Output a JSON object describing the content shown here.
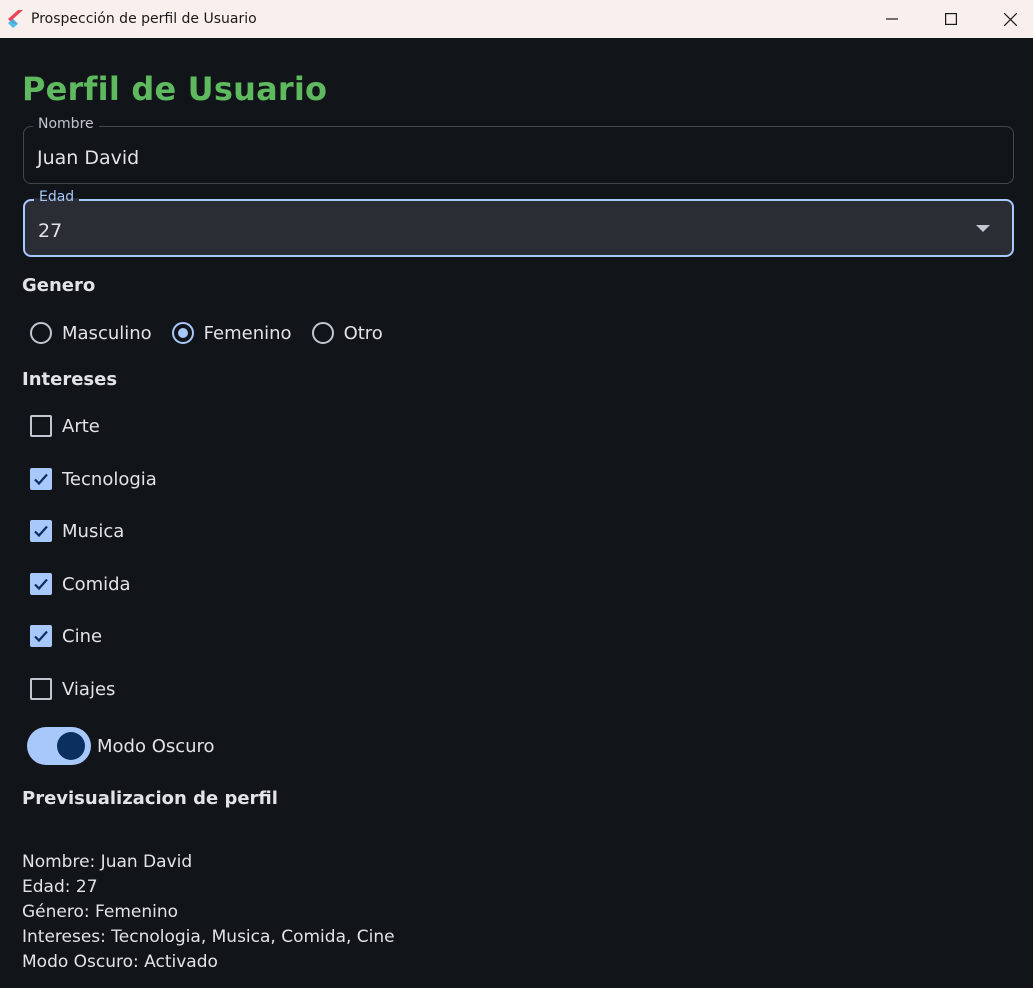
{
  "window": {
    "title": "Prospección de perfil de Usuario",
    "icon": "flutter-logo-icon"
  },
  "page": {
    "title": "Perfil de Usuario"
  },
  "form": {
    "nombre": {
      "label": "Nombre",
      "value": "Juan David"
    },
    "edad": {
      "label": "Edad",
      "value": "27",
      "focused": true
    }
  },
  "genero": {
    "label": "Genero",
    "options": [
      {
        "label": "Masculino",
        "selected": false
      },
      {
        "label": "Femenino",
        "selected": true
      },
      {
        "label": "Otro",
        "selected": false
      }
    ]
  },
  "intereses": {
    "label": "Intereses",
    "items": [
      {
        "label": "Arte",
        "checked": false
      },
      {
        "label": "Tecnologia",
        "checked": true
      },
      {
        "label": "Musica",
        "checked": true
      },
      {
        "label": "Comida",
        "checked": true
      },
      {
        "label": "Cine",
        "checked": true
      },
      {
        "label": "Viajes",
        "checked": false
      }
    ]
  },
  "modo_oscuro": {
    "label": "Modo Oscuro",
    "enabled": true
  },
  "preview": {
    "title": "Previsualizacion de perfil",
    "lines": [
      "Nombre: Juan David",
      "Edad: 27",
      "Género: Femenino",
      "Intereses: Tecnologia, Musica, Comida, Cine",
      "Modo Oscuro: Activado"
    ]
  },
  "colors": {
    "background": "#111418",
    "title_green": "#5fba5f",
    "accent": "#a8c7fa",
    "switch_thumb": "#0a305f"
  }
}
